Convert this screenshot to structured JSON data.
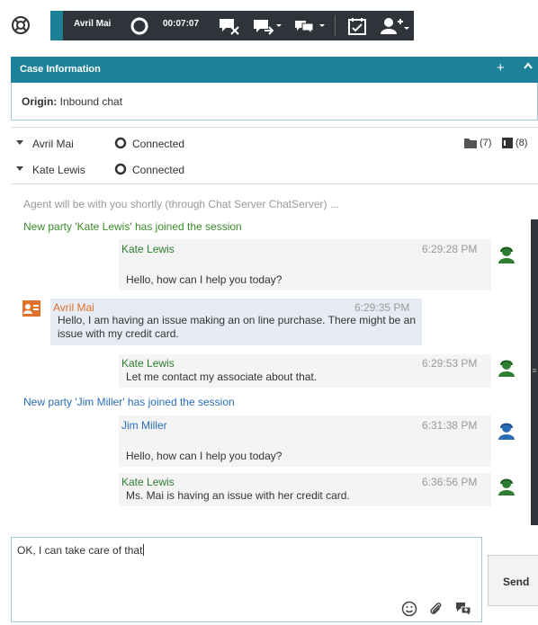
{
  "toolbar": {
    "contact_name": "Avril Mai",
    "timer": "00:07:07"
  },
  "case_info": {
    "title": "Case Information",
    "plus_label": "+",
    "origin_label": "Origin:",
    "origin_value": "Inbound chat"
  },
  "parties": [
    {
      "name": "Avril Mai",
      "status": "Connected"
    },
    {
      "name": "Kate Lewis",
      "status": "Connected"
    }
  ],
  "counts": {
    "cases": "(7)",
    "notes": "(8)"
  },
  "transcript": {
    "system_1": "Agent will be with you shortly (through Chat Server ChatServer) ...",
    "system_2": "New party 'Kate Lewis' has joined the session",
    "system_3": "New party 'Jim Miller' has joined the session",
    "messages": [
      {
        "sender": "Kate Lewis",
        "time": "6:29:28 PM",
        "text": "Hello, how can I help you today?"
      },
      {
        "sender": "Avril Mai",
        "time": "6:29:35 PM",
        "text": "Hello, I am having an issue making an on line purchase. There might be an issue with my credit card."
      },
      {
        "sender": "Kate Lewis",
        "time": "6:29:53 PM",
        "text": "Let me contact my associate about that."
      },
      {
        "sender": "Jim Miller",
        "time": "6:31:38 PM",
        "text": "Hello, how can I help you today?"
      },
      {
        "sender": "Kate Lewis",
        "time": "6:36:56 PM",
        "text": "Ms. Mai is having an issue with her credit card."
      }
    ]
  },
  "compose": {
    "text": "OK, I can take care of that",
    "send_label": "Send"
  },
  "colors": {
    "teal": "#1c8199",
    "dark_toolbar": "#2f343a",
    "system_green": "#3a8a2a",
    "system_blue": "#2a6db5",
    "customer_orange": "#e0702a",
    "agent_green": "#2e7d32"
  }
}
